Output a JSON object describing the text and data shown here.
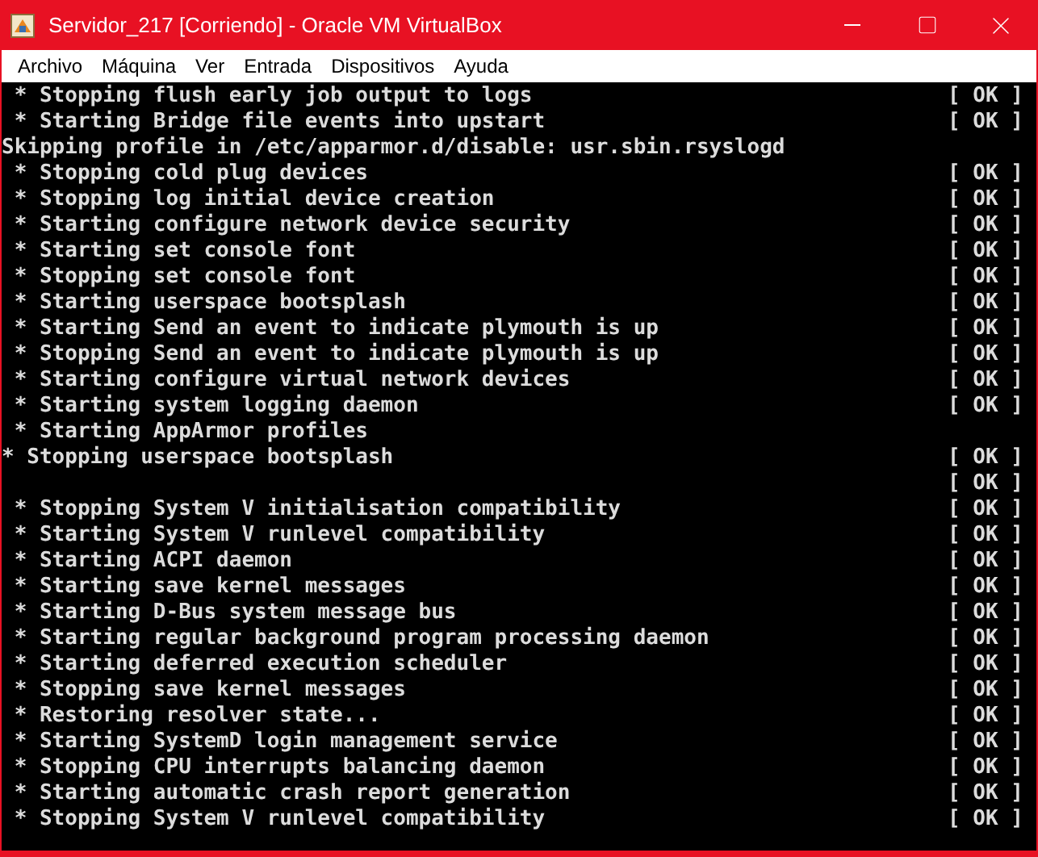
{
  "window": {
    "title": "Servidor_217 [Corriendo] - Oracle VM VirtualBox"
  },
  "menu": [
    "Archivo",
    "Máquina",
    "Ver",
    "Entrada",
    "Dispositivos",
    "Ayuda"
  ],
  "console": {
    "lines": [
      {
        "text": " * Stopping flush early job output to logs",
        "status": "[ OK ]"
      },
      {
        "text": " * Starting Bridge file events into upstart",
        "status": "[ OK ]"
      },
      {
        "text": "Skipping profile in /etc/apparmor.d/disable: usr.sbin.rsyslogd"
      },
      {
        "text": " * Stopping cold plug devices",
        "status": "[ OK ]"
      },
      {
        "text": " * Stopping log initial device creation",
        "status": "[ OK ]"
      },
      {
        "text": " * Starting configure network device security",
        "status": "[ OK ]"
      },
      {
        "text": " * Starting set console font",
        "status": "[ OK ]"
      },
      {
        "text": " * Stopping set console font",
        "status": "[ OK ]"
      },
      {
        "text": " * Starting userspace bootsplash",
        "status": "[ OK ]"
      },
      {
        "text": " * Starting Send an event to indicate plymouth is up",
        "status": "[ OK ]"
      },
      {
        "text": " * Stopping Send an event to indicate plymouth is up",
        "status": "[ OK ]"
      },
      {
        "text": " * Starting configure virtual network devices",
        "status": "[ OK ]"
      },
      {
        "text": " * Starting system logging daemon",
        "status": "[ OK ]"
      },
      {
        "text": " * Starting AppArmor profiles"
      },
      {
        "text": "* Stopping userspace bootsplash",
        "status": "[ OK ]"
      },
      {
        "status": "[ OK ]"
      },
      {
        "text": " * Stopping System V initialisation compatibility",
        "status": "[ OK ]"
      },
      {
        "text": " * Starting System V runlevel compatibility",
        "status": "[ OK ]"
      },
      {
        "text": " * Starting ACPI daemon",
        "status": "[ OK ]"
      },
      {
        "text": " * Starting save kernel messages",
        "status": "[ OK ]"
      },
      {
        "text": " * Starting D-Bus system message bus",
        "status": "[ OK ]"
      },
      {
        "text": " * Starting regular background program processing daemon",
        "status": "[ OK ]"
      },
      {
        "text": " * Starting deferred execution scheduler",
        "status": "[ OK ]"
      },
      {
        "text": " * Stopping save kernel messages",
        "status": "[ OK ]"
      },
      {
        "text": " * Restoring resolver state...",
        "status": "[ OK ]"
      },
      {
        "text": " * Starting SystemD login management service",
        "status": "[ OK ]"
      },
      {
        "text": " * Stopping CPU interrupts balancing daemon",
        "status": "[ OK ]"
      },
      {
        "text": " * Starting automatic crash report generation",
        "status": "[ OK ]"
      },
      {
        "text": " * Stopping System V runlevel compatibility",
        "status": "[ OK ]"
      }
    ]
  }
}
